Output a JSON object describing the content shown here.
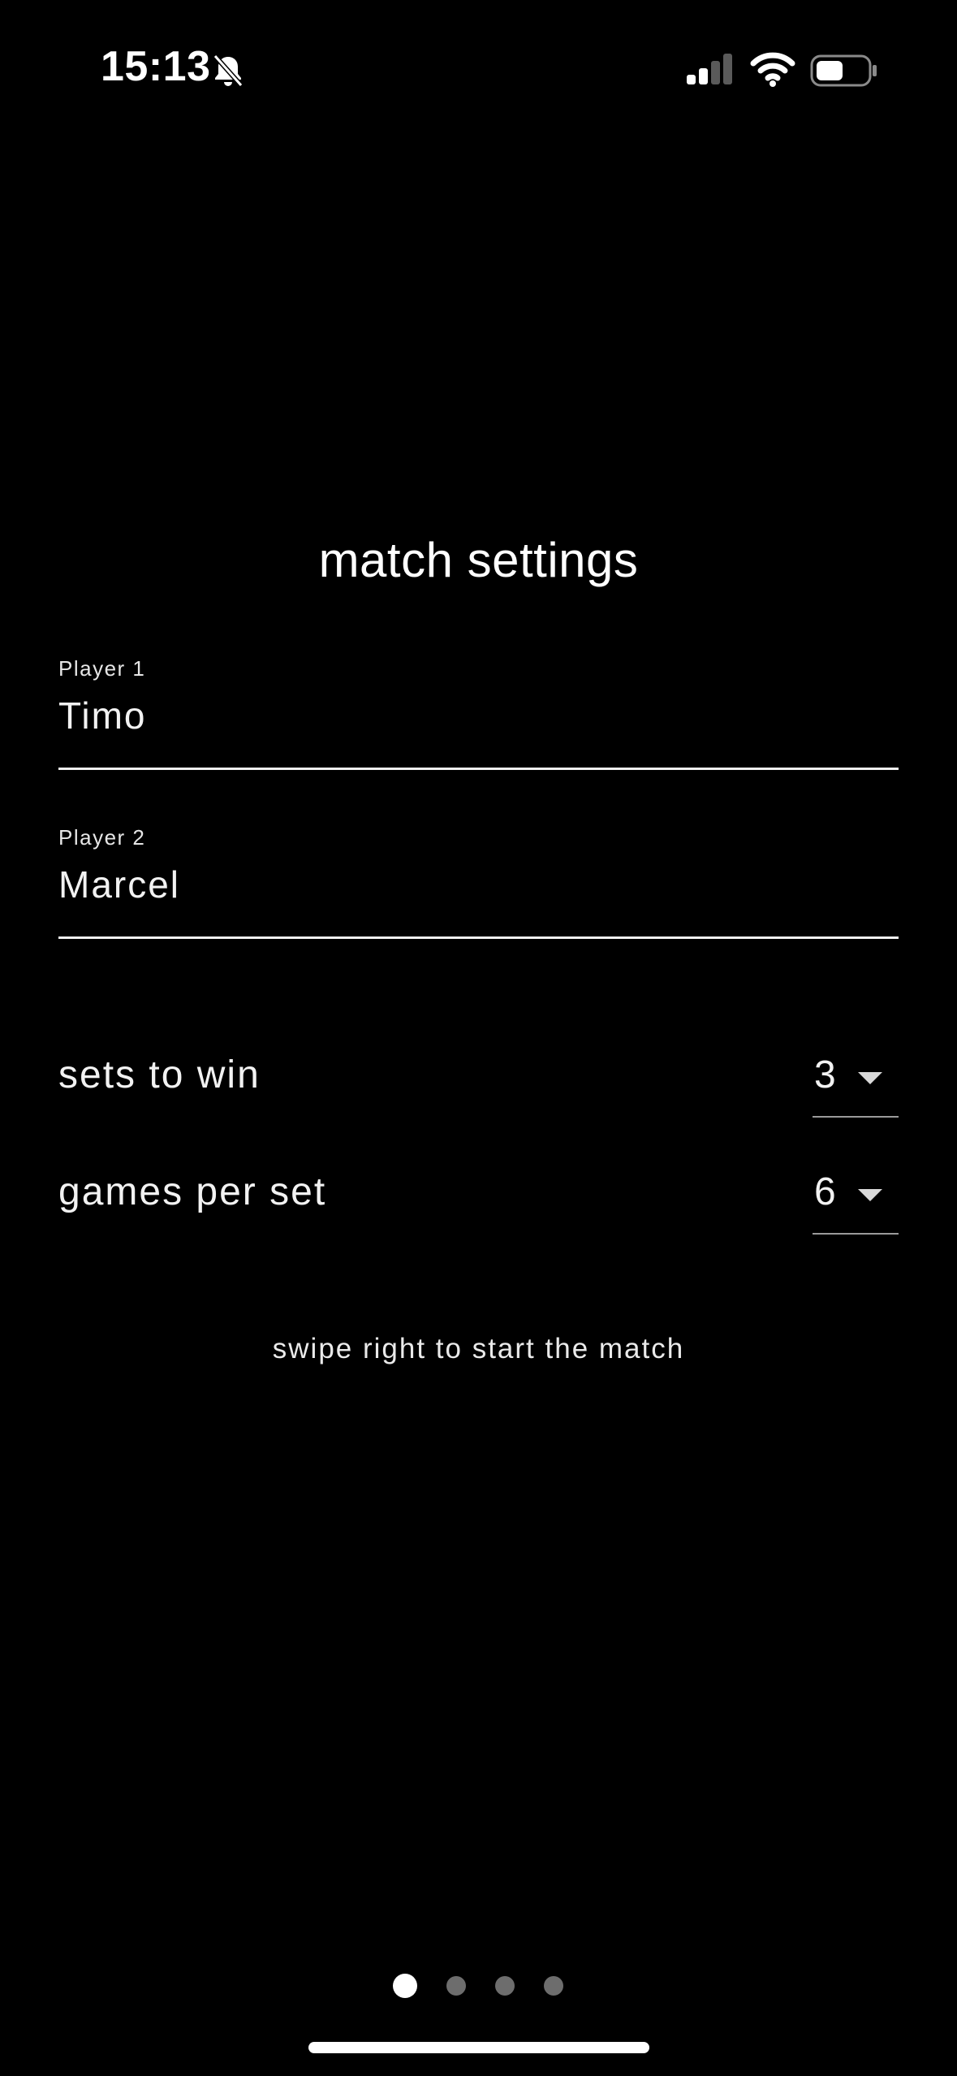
{
  "status_bar": {
    "time": "15:13",
    "icons": [
      "bell-slash-icon",
      "cellular-signal-icon",
      "wifi-icon",
      "battery-icon"
    ]
  },
  "title": "match settings",
  "players": [
    {
      "label": "Player 1",
      "value": "Timo"
    },
    {
      "label": "Player 2",
      "value": "Marcel"
    }
  ],
  "settings": [
    {
      "label": "sets to win",
      "value": "3"
    },
    {
      "label": "games per set",
      "value": "6"
    }
  ],
  "hint": "swipe right to start the match",
  "pager": {
    "total": 4,
    "active": 1
  },
  "colors": {
    "background": "#000000",
    "text": "#ffffff",
    "inactive_dot": "#6d6d6d"
  }
}
